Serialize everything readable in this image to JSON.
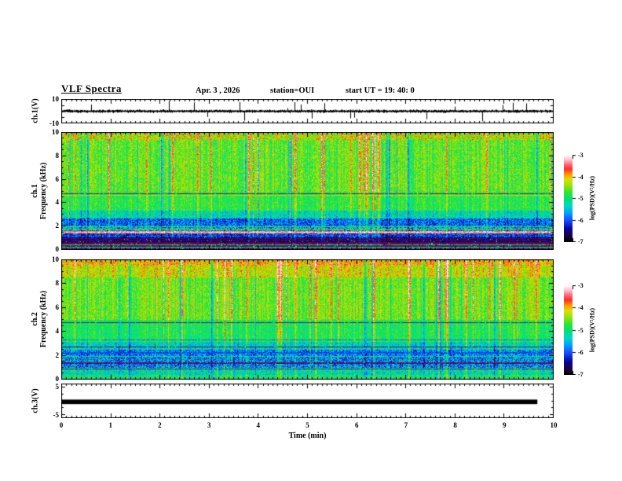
{
  "title": "VLF Spectra",
  "header": {
    "date": "Apr. 3 , 2026",
    "station": "station=OUI",
    "start_ut": "start UT =  19: 40: 0"
  },
  "xaxis": {
    "label": "Time (min)",
    "ticks": [
      "0",
      "1",
      "2",
      "3",
      "4",
      "5",
      "6",
      "7",
      "8",
      "9",
      "10"
    ]
  },
  "panels": {
    "ch1_wave": {
      "ylabel": "ch.1(V)",
      "ytick_top": "10",
      "ytick_bottom": "-10"
    },
    "ch1_spec": {
      "ylabel_channel": "ch.1",
      "ylabel_axis": "Frequency (kHz)",
      "yticks": [
        "0",
        "2",
        "4",
        "6",
        "8",
        "10"
      ]
    },
    "ch2_spec": {
      "ylabel_channel": "ch.2",
      "ylabel_axis": "Frequency (kHz)",
      "yticks": [
        "0",
        "2",
        "4",
        "6",
        "8",
        "10"
      ]
    },
    "ch3_wave": {
      "ylabel": "ch.3(V)",
      "ytick_top": "5",
      "ytick_bottom": "-5"
    }
  },
  "colorbar": {
    "label": "log(PSD)(V²/Hz)",
    "ticks": [
      "-3",
      "-4",
      "-5",
      "-6",
      "-7"
    ]
  },
  "chart_data": {
    "type": "multi-panel",
    "time_axis": {
      "label": "Time (min)",
      "range": [
        0,
        10
      ],
      "major_tick": 1,
      "minor_tick": 0.1
    },
    "colorbar": {
      "label": "log(PSD)(V²/Hz)",
      "top_value": -3,
      "bottom_value": -7,
      "ticks": [
        -3,
        -4,
        -5,
        -6,
        -7
      ]
    },
    "palette": [
      [
        0.0,
        0,
        0,
        0
      ],
      [
        0.07,
        25,
        0,
        70
      ],
      [
        0.15,
        5,
        5,
        160
      ],
      [
        0.24,
        25,
        70,
        255
      ],
      [
        0.33,
        0,
        160,
        255
      ],
      [
        0.41,
        0,
        215,
        205
      ],
      [
        0.49,
        0,
        225,
        120
      ],
      [
        0.57,
        45,
        230,
        45
      ],
      [
        0.65,
        150,
        230,
        10
      ],
      [
        0.72,
        225,
        220,
        0
      ],
      [
        0.78,
        255,
        150,
        0
      ],
      [
        0.84,
        255,
        45,
        45
      ],
      [
        0.9,
        255,
        115,
        135
      ],
      [
        0.95,
        255,
        195,
        205
      ],
      [
        1.0,
        255,
        255,
        255
      ]
    ],
    "tints": {
      "maroon": [
        125,
        0,
        45
      ]
    },
    "panels": [
      {
        "id": "ch1-waveform",
        "type": "line",
        "ylabel": "ch.1(V)",
        "ylim": [
          -10,
          10
        ],
        "description": "broadband noise trace ~±2 V with sparse spikes to ±9 V",
        "noise_base_V": 0.5,
        "noise_amp_V": 1.6,
        "spike_prob": 0.01,
        "spike_max_V": 8.5
      },
      {
        "id": "ch1-spectrogram",
        "type": "heatmap",
        "ylabel": "ch.1 Frequency (kHz)",
        "ylim": [
          0,
          10
        ],
        "fmax": 10,
        "bands": [
          {
            "f": [
              9.35,
              10
            ],
            "v": 0.68,
            "n": 0.14,
            "sw": 0.8,
            "spk": 0.01
          },
          {
            "f": [
              4.95,
              9.35
            ],
            "v": 0.6,
            "n": 0.11,
            "sw": 1.0
          },
          {
            "f": [
              3.35,
              4.95
            ],
            "v": 0.55,
            "n": 0.09,
            "sw": 0.7
          },
          {
            "f": [
              2.65,
              3.35
            ],
            "v": 0.44,
            "n": 0.13,
            "sw": 0.6
          },
          {
            "f": [
              2.05,
              2.65
            ],
            "v": 0.27,
            "n": 0.13,
            "sw": 0.5
          },
          {
            "f": [
              1.6,
              2.05
            ],
            "v": 0.33,
            "n": 0.17,
            "sw": 0.5
          },
          {
            "f": [
              1.38,
              1.6
            ],
            "v": 0.86,
            "n": 0.12,
            "sw": 0.2
          },
          {
            "f": [
              1.02,
              1.38
            ],
            "v": 0.22,
            "n": 0.12,
            "sw": 0.4,
            "spk": 0.02
          },
          {
            "f": [
              0.55,
              1.02
            ],
            "v": 0.1,
            "n": 0.08,
            "sw": 0.3,
            "spk": 0.03
          },
          {
            "f": [
              0.26,
              0.55
            ],
            "v": 0.16,
            "n": 0.1,
            "sw": 0.3,
            "tint": "maroon",
            "spk": 0.05
          },
          {
            "f": [
              0.0,
              0.26
            ],
            "v": 0.45,
            "n": 0.15,
            "sw": 0.5
          }
        ],
        "hlines": [
          {
            "f": 4.75,
            "w": 0.04,
            "v": 0.3,
            "tint": "maroon"
          },
          {
            "f": 4.62,
            "w": 0.04,
            "v": 0.72
          },
          {
            "f": 1.93,
            "w": 0.04,
            "v": 0.55
          },
          {
            "f": 1.77,
            "w": 0.04,
            "v": 0.62
          },
          {
            "f": 1.48,
            "w": 0.06,
            "v": 0.95
          },
          {
            "f": 0.95,
            "w": 0.04,
            "v": 0.18,
            "tint": "maroon"
          },
          {
            "f": 0.78,
            "w": 0.04,
            "v": 0.2,
            "tint": "maroon"
          },
          {
            "f": 0.62,
            "w": 0.04,
            "v": 0.16,
            "tint": "maroon"
          },
          {
            "f": 0.4,
            "w": 0.03,
            "v": 0.52
          },
          {
            "f": 0.08,
            "w": 0.08,
            "v": 0.3,
            "tint": "maroon"
          }
        ]
      },
      {
        "id": "ch2-spectrogram",
        "type": "heatmap",
        "ylabel": "ch.2 Frequency (kHz)",
        "ylim": [
          0,
          10
        ],
        "fmax": 10,
        "bands": [
          {
            "f": [
              9.5,
              10
            ],
            "v": 0.76,
            "n": 0.1,
            "sw": 0.8
          },
          {
            "f": [
              8.5,
              9.5
            ],
            "v": 0.7,
            "n": 0.1,
            "sw": 0.9
          },
          {
            "f": [
              5.0,
              8.5
            ],
            "v": 0.62,
            "n": 0.1,
            "sw": 1.0
          },
          {
            "f": [
              3.1,
              5.0
            ],
            "v": 0.53,
            "n": 0.09,
            "sw": 0.7
          },
          {
            "f": [
              2.45,
              3.1
            ],
            "v": 0.42,
            "n": 0.13,
            "sw": 0.6
          },
          {
            "f": [
              1.65,
              2.45
            ],
            "v": 0.3,
            "n": 0.15,
            "sw": 0.5,
            "spk": 0.02
          },
          {
            "f": [
              0.95,
              1.65
            ],
            "v": 0.3,
            "n": 0.16,
            "sw": 0.5,
            "spk": 0.02
          },
          {
            "f": [
              0.38,
              0.95
            ],
            "v": 0.44,
            "n": 0.14,
            "sw": 0.5
          },
          {
            "f": [
              0.0,
              0.38
            ],
            "v": 0.5,
            "n": 0.13,
            "sw": 0.5
          }
        ],
        "hlines": [
          {
            "f": 4.75,
            "w": 0.05,
            "v": 0.25,
            "tint": "maroon"
          },
          {
            "f": 3.3,
            "w": 0.04,
            "v": 0.28
          },
          {
            "f": 2.7,
            "w": 0.04,
            "v": 0.2,
            "tint": "maroon"
          },
          {
            "f": 2.2,
            "w": 0.04,
            "v": 0.24
          },
          {
            "f": 1.9,
            "w": 0.03,
            "v": 0.5
          },
          {
            "f": 1.35,
            "w": 0.04,
            "v": 0.22,
            "tint": "maroon"
          },
          {
            "f": 0.85,
            "w": 0.04,
            "v": 0.25,
            "tint": "maroon"
          }
        ]
      },
      {
        "id": "ch3-waveform",
        "type": "line",
        "ylabel": "ch.3(V)",
        "ylim": [
          -6,
          6
        ],
        "description": "constant thick flat line",
        "bar_value_V": -0.5,
        "bar_halfwidth_V": 0.8,
        "bar_start_min": 0,
        "bar_end_min": 9.7
      }
    ]
  }
}
